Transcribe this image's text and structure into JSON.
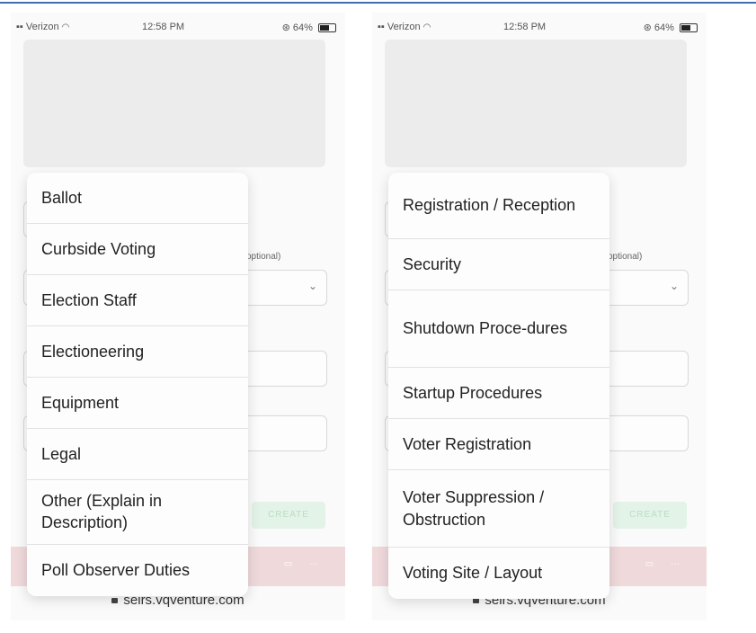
{
  "status_bar": {
    "carrier": "Verizon",
    "time": "12:58 PM",
    "battery": "64%"
  },
  "background_form": {
    "field_hint": "optional)",
    "create_button": "CREATE"
  },
  "url": "seirs.vqventure.com",
  "left_menu": {
    "items": [
      "Ballot",
      "Curbside Voting",
      "Election Staff",
      "Electioneering",
      "Equipment",
      "Legal",
      "Other (Explain in Description)",
      "Poll Observer Duties"
    ]
  },
  "right_menu": {
    "items": [
      "Registration / Reception",
      "Security",
      "Shutdown Proce-dures",
      "Startup Procedures",
      "Voter Registration",
      "Voter Suppression / Obstruction",
      "Voting Site / Layout"
    ]
  }
}
